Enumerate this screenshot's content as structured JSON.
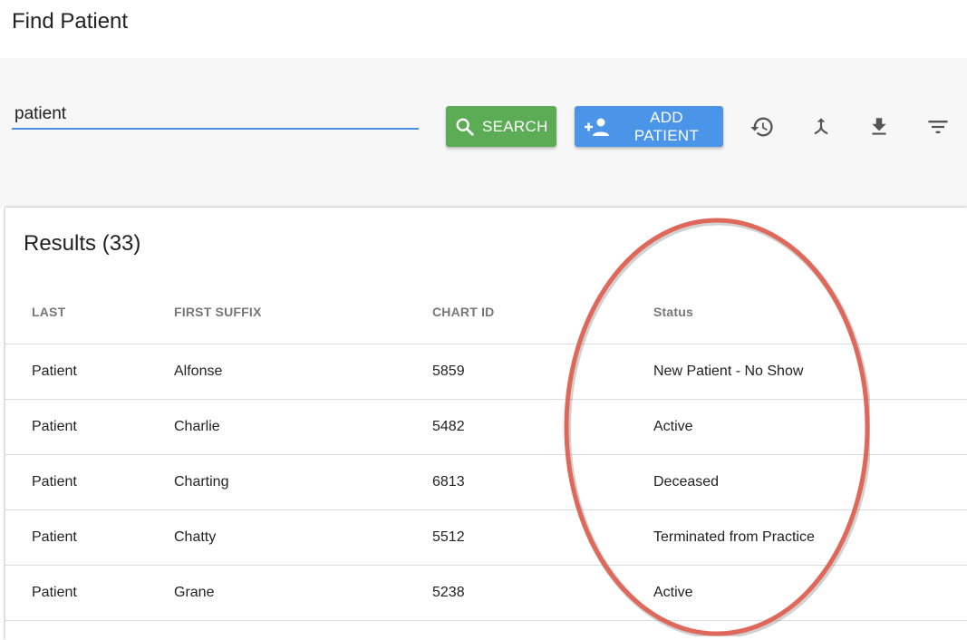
{
  "header": {
    "title": "Find Patient"
  },
  "search": {
    "value": "patient",
    "search_label": "SEARCH",
    "add_label": "ADD PATIENT"
  },
  "toolbar_icons": [
    "history-icon",
    "merge-icon",
    "download-icon",
    "filter-icon"
  ],
  "results": {
    "title": "Results (33)",
    "columns": [
      "LAST",
      "FIRST SUFFIX",
      "CHART ID",
      "Status"
    ],
    "rows": [
      {
        "last": "Patient",
        "first": "Alfonse",
        "chart_id": "5859",
        "status": "New Patient - No Show"
      },
      {
        "last": "Patient",
        "first": "Charlie",
        "chart_id": "5482",
        "status": "Active"
      },
      {
        "last": "Patient",
        "first": "Charting",
        "chart_id": "6813",
        "status": "Deceased"
      },
      {
        "last": "Patient",
        "first": "Chatty",
        "chart_id": "5512",
        "status": "Terminated from Practice"
      },
      {
        "last": "Patient",
        "first": "Grane",
        "chart_id": "5238",
        "status": "Active"
      }
    ]
  },
  "colors": {
    "search_button": "#5cab55",
    "add_button": "#4a95e8",
    "input_underline": "#4a90e2",
    "annotation": "#e0685a"
  }
}
